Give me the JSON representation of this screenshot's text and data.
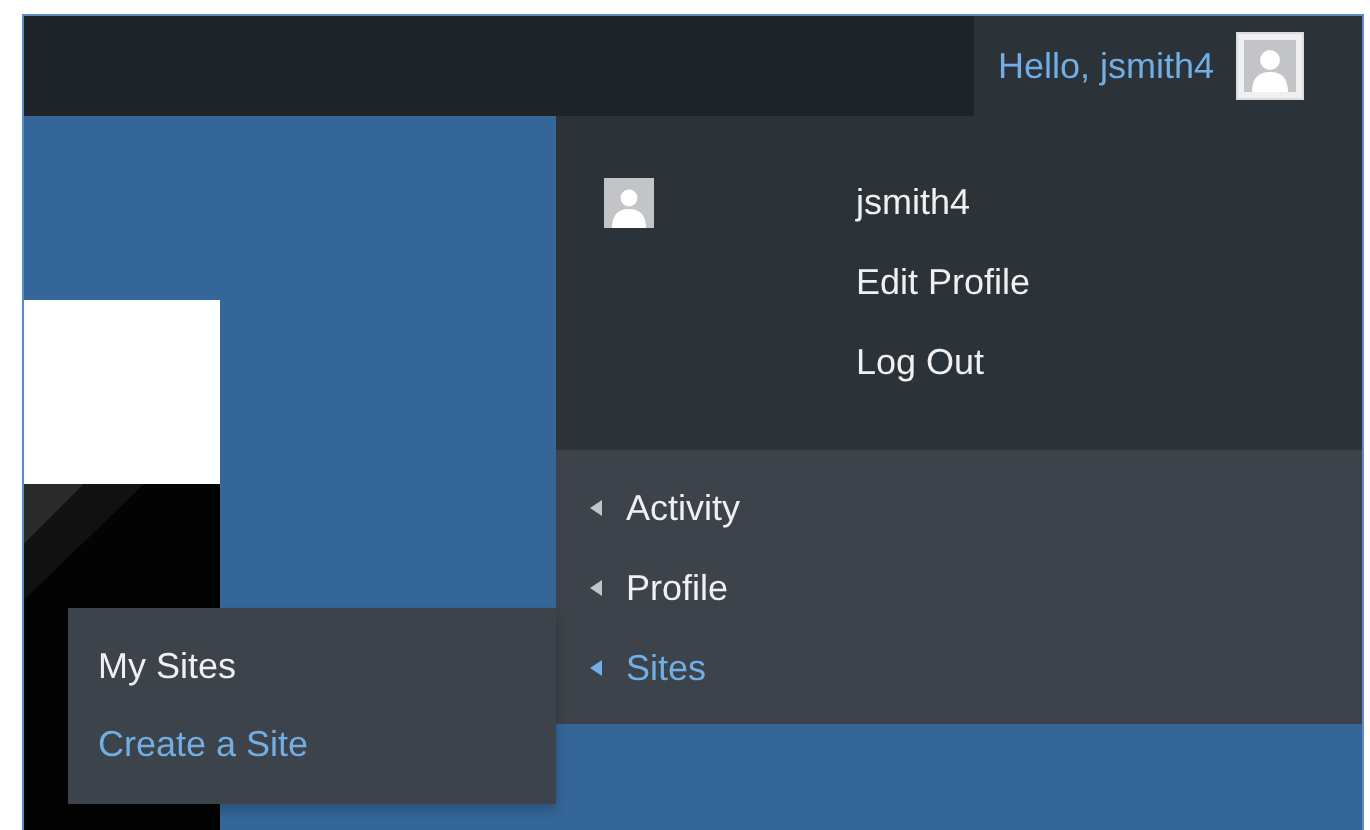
{
  "admin_bar": {
    "greeting": "Hello, jsmith4"
  },
  "account_menu": {
    "username": "jsmith4",
    "links": [
      {
        "label": "Edit Profile",
        "selected": false
      },
      {
        "label": "Log Out",
        "selected": false
      }
    ],
    "sections": [
      {
        "label": "Activity",
        "selected": false
      },
      {
        "label": "Profile",
        "selected": false
      },
      {
        "label": "Sites",
        "selected": true,
        "submenu": [
          {
            "label": "My Sites",
            "selected": false
          },
          {
            "label": "Create a Site",
            "selected": true
          }
        ]
      }
    ]
  }
}
